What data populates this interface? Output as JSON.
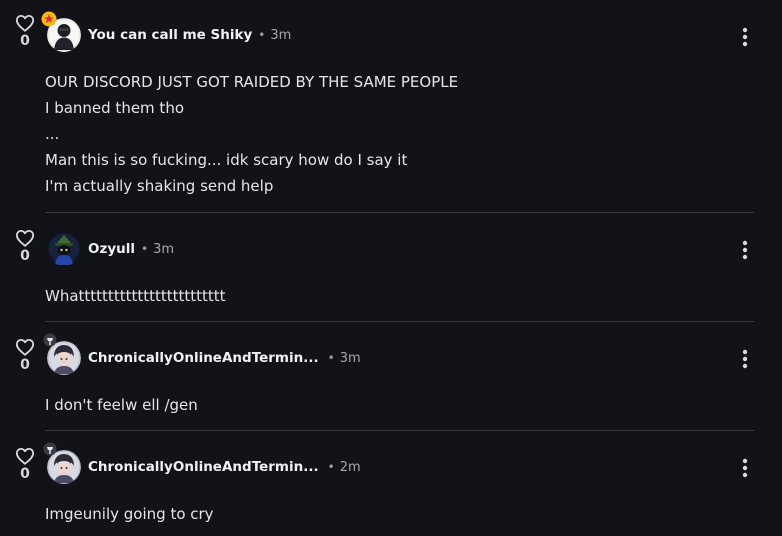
{
  "posts": [
    {
      "likes": "0",
      "username": "You can call me Shiky",
      "separator": "•",
      "time": "3m",
      "badge": "star-badge",
      "lines": [
        "OUR DISCORD JUST GOT RAIDED BY THE SAME PEOPLE",
        "I banned them tho",
        "...",
        "Man this is so fucking... idk scary how do I say it",
        "I'm actually shaking send help"
      ]
    },
    {
      "likes": "0",
      "username": "Ozyull",
      "separator": "•",
      "time": "3m",
      "lines": [
        "Whattttttttttttttttttttttttt"
      ]
    },
    {
      "likes": "0",
      "username": "ChronicallyOnlineAndTermin...",
      "separator": "•",
      "time": "3m",
      "badge": "pin-badge",
      "lines": [
        "I don't feelw ell /gen"
      ]
    },
    {
      "likes": "0",
      "username": "ChronicallyOnlineAndTermin...",
      "separator": "•",
      "time": "2m",
      "badge": "pin-badge",
      "lines": [
        "Imgeunily going to cry"
      ]
    }
  ],
  "colors": {
    "background": "#121318",
    "divider": "#3a3b42",
    "text": "#e6e6ea",
    "muted": "#a6a7ae",
    "badge_star": "#f5b914"
  },
  "icons": {
    "like": "heart-outline-icon",
    "menu": "vertical-ellipsis-icon"
  }
}
